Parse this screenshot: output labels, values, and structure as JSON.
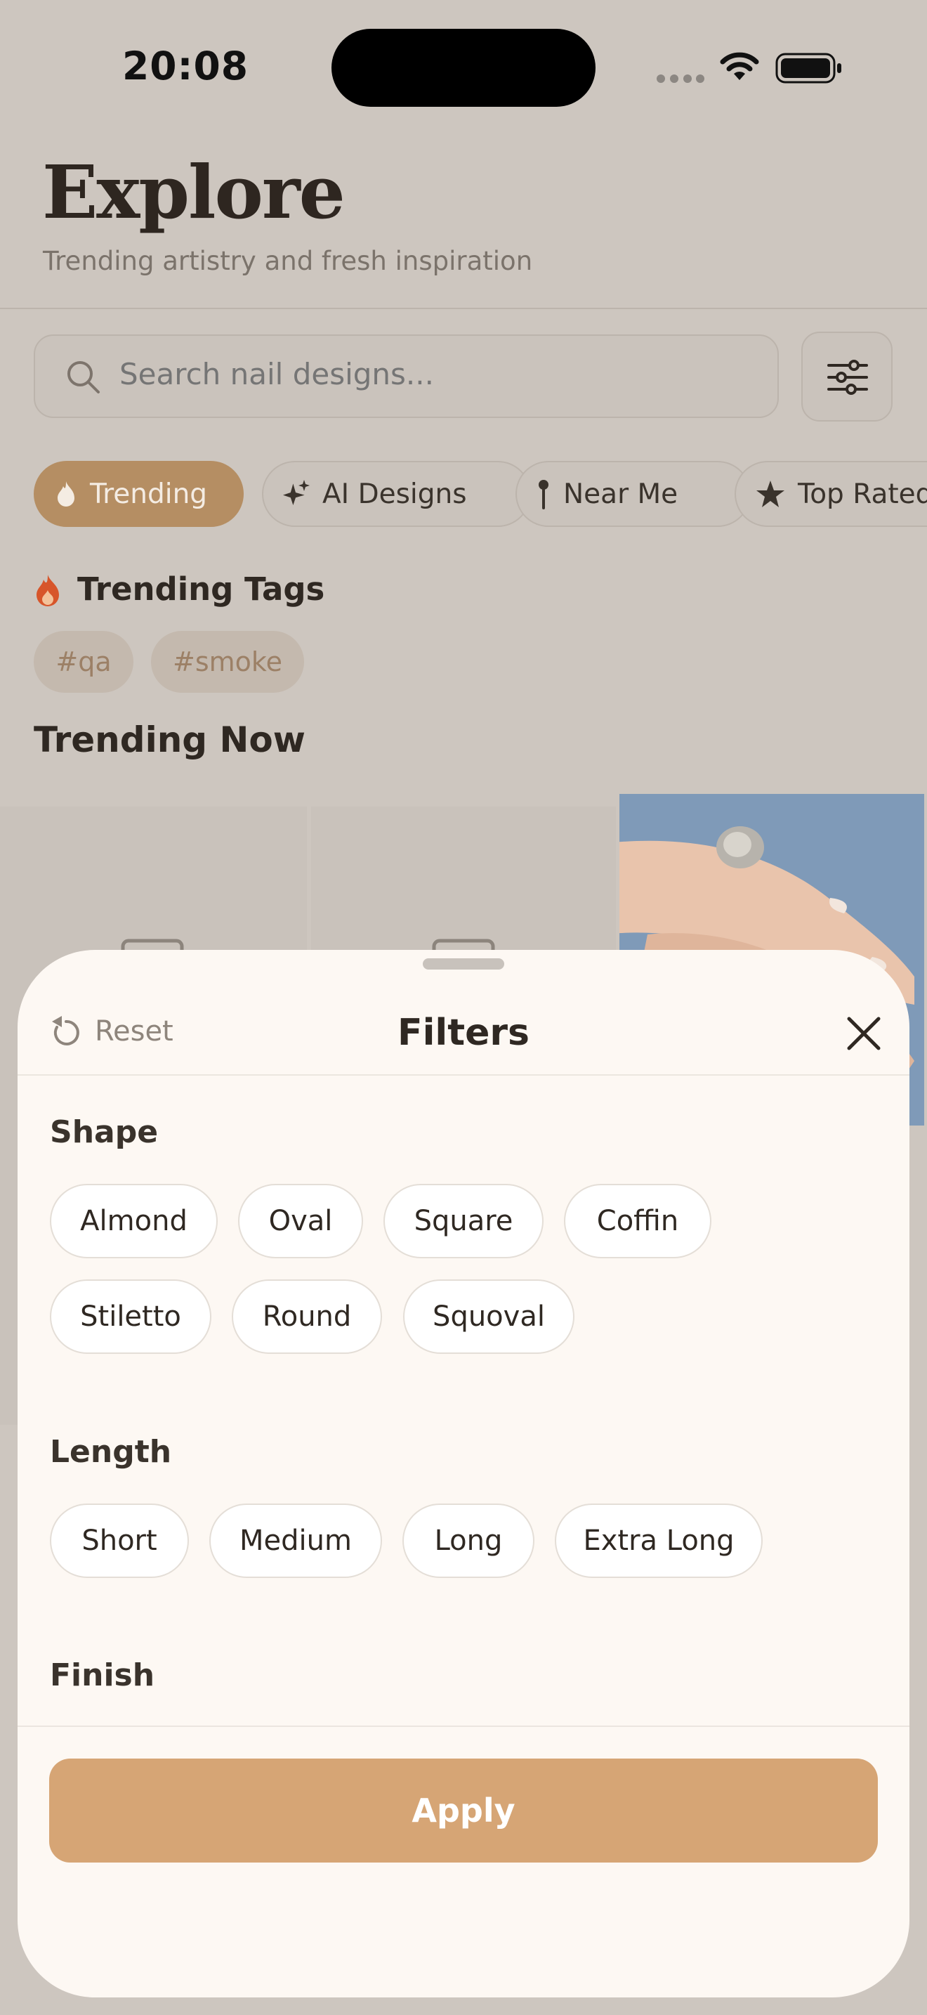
{
  "status_bar": {
    "time": "20:08"
  },
  "header": {
    "title": "Explore",
    "subtitle": "Trending artistry and fresh inspiration"
  },
  "search": {
    "placeholder": "Search nail designs..."
  },
  "category_chips": [
    {
      "label": "Trending",
      "icon": "flame-icon",
      "active": true
    },
    {
      "label": "AI Designs",
      "icon": "sparkle-icon",
      "active": false
    },
    {
      "label": "Near Me",
      "icon": "pin-icon",
      "active": false
    },
    {
      "label": "Top Rated",
      "icon": "star-icon",
      "active": false
    }
  ],
  "trending_tags": {
    "heading": "Trending Tags",
    "tags": [
      "#qa",
      "#smoke"
    ]
  },
  "trending_now": {
    "heading": "Trending Now"
  },
  "filters_sheet": {
    "reset_label": "Reset",
    "title": "Filters",
    "sections": [
      {
        "label": "Shape",
        "options": [
          "Almond",
          "Oval",
          "Square",
          "Coffin",
          "Stiletto",
          "Round",
          "Squoval"
        ]
      },
      {
        "label": "Length",
        "options": [
          "Short",
          "Medium",
          "Long",
          "Extra Long"
        ]
      },
      {
        "label": "Finish",
        "options": []
      }
    ],
    "apply_label": "Apply"
  },
  "colors": {
    "accent": "#d6a575",
    "active_chip": "#b58e63",
    "sheet_background": "#fdf8f3",
    "flame": "#d7552a"
  }
}
